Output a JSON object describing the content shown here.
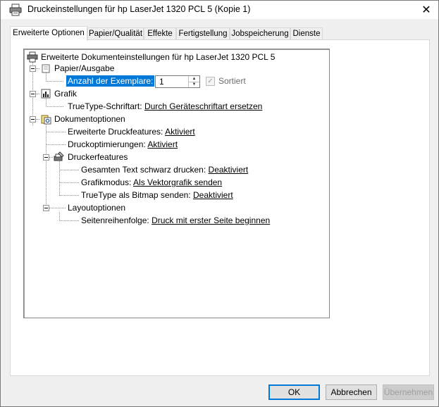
{
  "window": {
    "title": "Druckeinstellungen für hp LaserJet 1320 PCL 5 (Kopie 1)",
    "close_glyph": "✕"
  },
  "tabs": [
    {
      "label": "Erweiterte Optionen",
      "active": true
    },
    {
      "label": "Papier/Qualität"
    },
    {
      "label": "Effekte"
    },
    {
      "label": "Fertigstellung"
    },
    {
      "label": "Jobspeicherung"
    },
    {
      "label": "Dienste"
    }
  ],
  "tree": {
    "root": "Erweiterte Dokumenteinstellungen für hp LaserJet 1320 PCL 5",
    "papier": {
      "label": "Papier/Ausgabe",
      "copies_label": "Anzahl der Exemplare:",
      "copies_value": "1",
      "collate_label": "Sortiert"
    },
    "grafik": {
      "label": "Grafik",
      "truetype_label": "TrueType-Schriftart:",
      "truetype_value": "Durch Geräteschriftart ersetzen"
    },
    "dokument": {
      "label": "Dokumentoptionen",
      "erw_label": "Erweiterte Druckfeatures:",
      "erw_value": "Aktiviert",
      "opt_label": "Druckoptimierungen:",
      "opt_value": "Aktiviert",
      "druckerfeatures": {
        "label": "Druckerfeatures",
        "schwarz_label": "Gesamten Text schwarz drucken:",
        "schwarz_value": "Deaktiviert",
        "grafikmodus_label": "Grafikmodus:",
        "grafikmodus_value": "Als Vektorgrafik senden",
        "bitmap_label": "TrueType als Bitmap senden:",
        "bitmap_value": "Deaktiviert"
      },
      "layout": {
        "label": "Layoutoptionen",
        "seiten_label": "Seitenreihenfolge:",
        "seiten_value": "Druck mit erster Seite beginnen"
      }
    }
  },
  "buttons": {
    "ok": "OK",
    "cancel": "Abbrechen",
    "apply": "Übernehmen"
  },
  "colors": {
    "selection": "#0078d7",
    "default_button_border": "#0078d7"
  },
  "icons": {
    "title": "printer-icon",
    "root": "printer-icon",
    "papier": "paper-icon",
    "grafik": "chart-icon",
    "dokument": "document-options-icon",
    "druckerfeatures": "printer-features-icon"
  }
}
